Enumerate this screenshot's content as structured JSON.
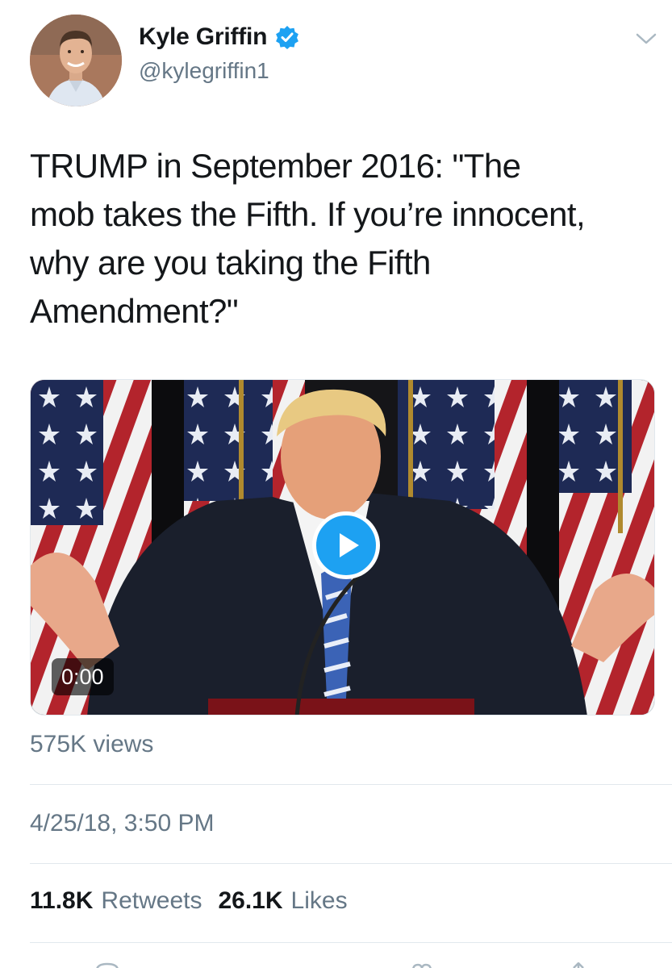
{
  "author": {
    "display_name": "Kyle Griffin",
    "handle": "@kylegriffin1",
    "verified_icon": "verified-badge-icon",
    "menu_icon": "chevron-down-icon"
  },
  "tweet": {
    "text_lines": [
      "TRUMP in September 2016: \"The",
      "mob takes the Fifth. If you’re innocent,",
      "why are you taking the Fifth",
      "Amendment?\""
    ]
  },
  "video": {
    "timecode": "0:00",
    "play_icon": "play-icon",
    "views": "575K views"
  },
  "timestamp": "4/25/18, 3:50 PM",
  "stats": {
    "retweets_count": "11.8K",
    "retweets_label": "Retweets",
    "likes_count": "26.1K",
    "likes_label": "Likes"
  },
  "colors": {
    "accent": "#1da1f2",
    "secondary_text": "#657786",
    "primary_text": "#14171a",
    "divider": "#e1e8ed"
  }
}
